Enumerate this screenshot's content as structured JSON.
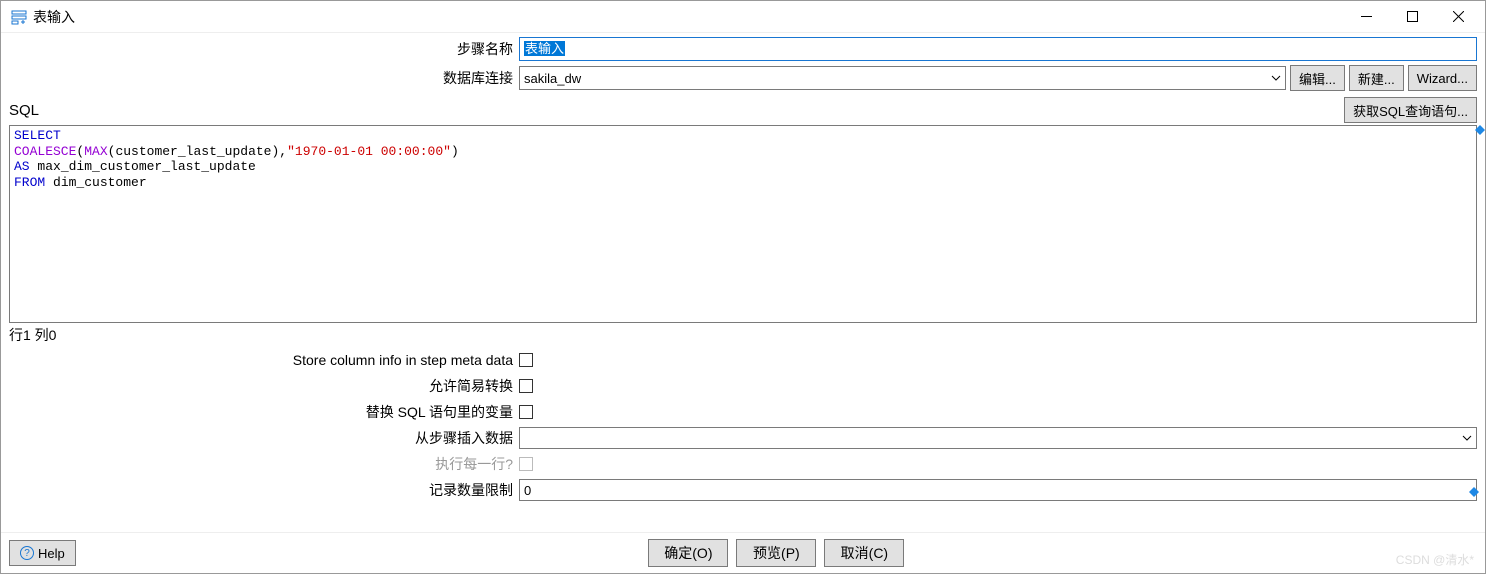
{
  "window": {
    "title": "表输入"
  },
  "form": {
    "step_name_label": "步骤名称",
    "step_name_value": "表输入",
    "db_conn_label": "数据库连接",
    "db_conn_value": "sakila_dw",
    "edit_btn": "编辑...",
    "new_btn": "新建...",
    "wizard_btn": "Wizard..."
  },
  "sql": {
    "label": "SQL",
    "get_sql_btn": "获取SQL查询语句...",
    "tokens": {
      "select": "SELECT",
      "coalesce": "COALESCE",
      "lparen1": "(",
      "max": "MAX",
      "lparen2": "(",
      "col1": "customer_last_update",
      "rparen2": ")",
      "comma": ",",
      "strlit": "\"1970-01-01 00:00:00\"",
      "rparen1": ")",
      "as": "AS",
      "alias": " max_dim_customer_last_update",
      "from": "FROM",
      "table": " dim_customer"
    },
    "status": "行1 列0"
  },
  "options": {
    "store_col_label": "Store column info in step meta data",
    "allow_conv_label": "允许简易转换",
    "replace_var_label": "替换 SQL 语句里的变量",
    "insert_from_label": "从步骤插入数据",
    "insert_from_value": "",
    "exec_each_label": "执行每一行?",
    "limit_label": "记录数量限制",
    "limit_value": "0"
  },
  "buttons": {
    "help": "Help",
    "ok": "确定(O)",
    "preview": "预览(P)",
    "cancel": "取消(C)"
  },
  "watermark": "CSDN @清水*"
}
